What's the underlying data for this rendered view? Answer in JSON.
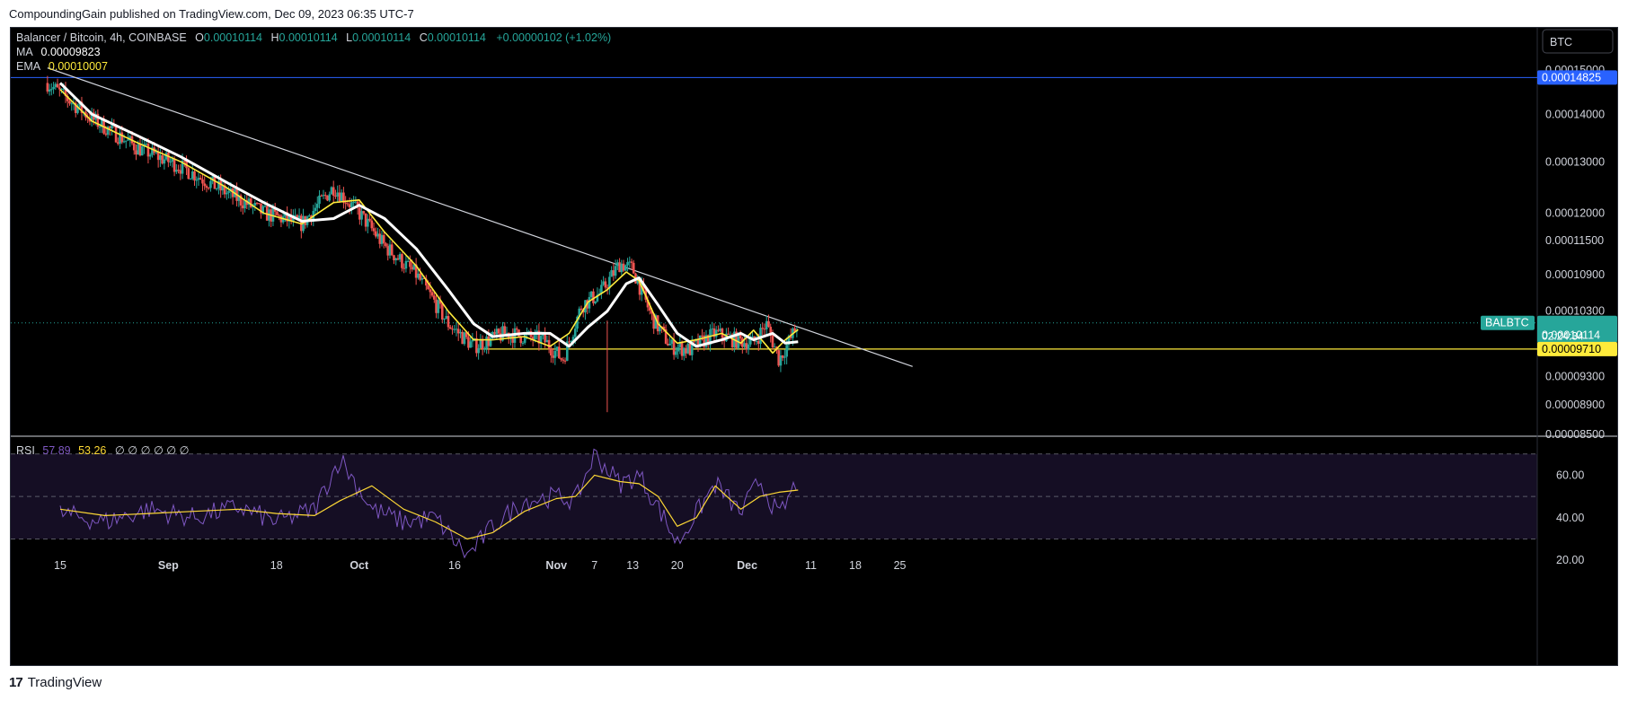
{
  "header": {
    "published": "CompoundingGain published on TradingView.com, Dec 09, 2023 06:35 UTC-7"
  },
  "legend": {
    "symbol": "Balancer / Bitcoin, 4h, COINBASE",
    "o_label": "O",
    "o_value": "0.00010114",
    "h_label": "H",
    "h_value": "0.00010114",
    "l_label": "L",
    "l_value": "0.00010114",
    "c_label": "C",
    "c_value": "0.00010114",
    "change": "+0.00000102 (+1.02%)",
    "ma_label": "MA",
    "ma_value": "0.00009823",
    "ema_label": "EMA",
    "ema_value": "0.00010007",
    "rsi_label": "RSI",
    "rsi_value": "57.89",
    "rsi_ma_value": "53.26",
    "rsi_extra": "∅ ∅ ∅ ∅ ∅ ∅"
  },
  "currency_button": "BTC",
  "badges": {
    "blue_line": "0.00014825",
    "symbol_tag": "BALBTC",
    "last_price": "0.00010114",
    "countdown": "02:24:34",
    "support": "0.00009710"
  },
  "footer": {
    "brand": "TradingView",
    "logo": "17"
  },
  "colors": {
    "up": "#26a69a",
    "down": "#ef5350",
    "ma": "#ffffff",
    "ema": "#ffeb3b",
    "rsi": "#7e57c2",
    "rsi_ma": "#fdd835",
    "blue_line": "#2962ff",
    "support": "#ffeb3b",
    "trendline": "#d1d4dc"
  },
  "chart_data": [
    {
      "type": "candlestick",
      "title": "Balancer / Bitcoin, 4h, COINBASE",
      "y_scale": "log",
      "ylim": [
        8.3e-05,
        0.000154
      ],
      "y_ticks": [
        "0.00015000",
        "0.00014000",
        "0.00013000",
        "0.00012000",
        "0.00011500",
        "0.00010900",
        "0.00010300",
        "0.00009300",
        "0.00008900",
        "0.00008500"
      ],
      "x_ticks": [
        "15",
        "Sep",
        "18",
        "Oct",
        "16",
        "Nov",
        "7",
        "13",
        "20",
        "Dec",
        "11",
        "18",
        "25"
      ],
      "series": [
        {
          "name": "MA",
          "points": [
            [
              "Aug 15",
              0.000147
            ],
            [
              "Aug 20",
              0.00014
            ],
            [
              "Aug 27",
              0.0001355
            ],
            [
              "Sep 3",
              0.000131
            ],
            [
              "Sep 10",
              0.000126
            ],
            [
              "Sep 16",
              0.000122
            ],
            [
              "Sep 22",
              0.0001185
            ],
            [
              "Sep 27",
              0.000119
            ],
            [
              "Oct 1",
              0.0001215
            ],
            [
              "Oct 5",
              0.000119
            ],
            [
              "Oct 10",
              0.0001135
            ],
            [
              "Oct 15",
              0.0001065
            ],
            [
              "Oct 19",
              0.000101
            ],
            [
              "Oct 22",
              9.9e-05
            ],
            [
              "Oct 27",
              9.95e-05
            ],
            [
              "Oct 31",
              9.95e-05
            ],
            [
              "Nov 3",
              9.75e-05
            ],
            [
              "Nov 6",
              0.0001005
            ],
            [
              "Nov 9",
              0.000103
            ],
            [
              "Nov 12",
              0.0001075
            ],
            [
              "Nov 14",
              0.0001085
            ],
            [
              "Nov 17",
              0.000104
            ],
            [
              "Nov 20",
              9.95e-05
            ],
            [
              "Nov 23",
              9.75e-05
            ],
            [
              "Nov 27",
              9.85e-05
            ],
            [
              "Nov 30",
              9.95e-05
            ],
            [
              "Dec 2",
              9.85e-05
            ],
            [
              "Dec 5",
              9.95e-05
            ],
            [
              "Dec 7",
              9.8e-05
            ],
            [
              "Dec 9",
              9.82e-05
            ]
          ]
        },
        {
          "name": "EMA",
          "points": [
            [
              "Aug 15",
              0.0001455
            ],
            [
              "Aug 20",
              0.0001385
            ],
            [
              "Aug 27",
              0.000134
            ],
            [
              "Sep 3",
              0.00013
            ],
            [
              "Sep 10",
              0.000125
            ],
            [
              "Sep 16",
              0.00012
            ],
            [
              "Sep 22",
              0.000118
            ],
            [
              "Sep 27",
              0.000122
            ],
            [
              "Oct 1",
              0.0001225
            ],
            [
              "Oct 5",
              0.0001165
            ],
            [
              "Oct 10",
              0.0001105
            ],
            [
              "Oct 15",
              0.000103
            ],
            [
              "Oct 19",
              9.85e-05
            ],
            [
              "Oct 22",
              9.85e-05
            ],
            [
              "Oct 27",
              9.9e-05
            ],
            [
              "Oct 31",
              9.75e-05
            ],
            [
              "Nov 3",
              9.95e-05
            ],
            [
              "Nov 6",
              0.0001045
            ],
            [
              "Nov 9",
              0.0001065
            ],
            [
              "Nov 12",
              0.0001095
            ],
            [
              "Nov 14",
              0.000108
            ],
            [
              "Nov 17",
              0.000101
            ],
            [
              "Nov 20",
              9.8e-05
            ],
            [
              "Nov 23",
              9.85e-05
            ],
            [
              "Nov 27",
              9.95e-05
            ],
            [
              "Nov 30",
              9.8e-05
            ],
            [
              "Dec 2",
              0.0001
            ],
            [
              "Dec 5",
              9.65e-05
            ],
            [
              "Dec 7",
              9.85e-05
            ],
            [
              "Dec 9",
              0.0001001
            ]
          ]
        }
      ],
      "price_path": [
        [
          "Aug 13",
          0.000147
        ],
        [
          "Aug 20",
          0.000139
        ],
        [
          "Aug 27",
          0.000133
        ],
        [
          "Sep 3",
          0.000129
        ],
        [
          "Sep 10",
          0.000124
        ],
        [
          "Sep 16",
          0.00012
        ],
        [
          "Sep 22",
          0.000118
        ],
        [
          "Sep 27",
          0.000125
        ],
        [
          "Oct 1",
          0.00012
        ],
        [
          "Oct 5",
          0.000114
        ],
        [
          "Oct 10",
          0.000109
        ],
        [
          "Oct 15",
          0.000101
        ],
        [
          "Oct 19",
          9.75e-05
        ],
        [
          "Oct 24",
          9.95e-05
        ],
        [
          "Oct 30",
          9.85e-05
        ],
        [
          "Nov 2",
          9.55e-05
        ],
        [
          "Nov 5",
          0.000104
        ],
        [
          "Nov 8",
          0.000106
        ],
        [
          "Nov 11",
          0.000111
        ],
        [
          "Nov 13",
          0.00011
        ],
        [
          "Nov 16",
          0.000102
        ],
        [
          "Nov 19",
          9.75e-05
        ],
        [
          "Nov 22",
          9.7e-05
        ],
        [
          "Nov 26",
          9.95e-05
        ],
        [
          "Nov 29",
          9.85e-05
        ],
        [
          "Dec 2",
          9.8e-05
        ],
        [
          "Dec 4",
          0.000101
        ],
        [
          "Dec 6",
          9.55e-05
        ],
        [
          "Dec 8",
          9.9e-05
        ],
        [
          "Dec 9",
          0.0001011
        ]
      ],
      "candle_colors": "green = up, red = down",
      "horizontal_lines": [
        {
          "value": 0.00014825,
          "label": "0.00014825"
        },
        {
          "value": 9.71e-05,
          "label": "0.00009710",
          "from": "Oct 20"
        }
      ],
      "trendline": {
        "from": [
          "Aug 13",
          0.0001505
        ],
        "to": [
          "Dec 27",
          9.45e-05
        ]
      },
      "wick_spike_low": [
        "Nov 9",
        8.8e-05
      ]
    },
    {
      "type": "line",
      "title": "RSI",
      "ylim": [
        15,
        72
      ],
      "y_ticks": [
        "60.00",
        "40.00",
        "20.00"
      ],
      "bands": [
        30,
        50,
        70
      ],
      "series": [
        {
          "name": "RSI",
          "points": [
            [
              "Aug 15",
              42
            ],
            [
              "Aug 22",
              38
            ],
            [
              "Aug 29",
              44
            ],
            [
              "Sep 5",
              40
            ],
            [
              "Sep 12",
              45
            ],
            [
              "Sep 18",
              38
            ],
            [
              "Sep 24",
              44
            ],
            [
              "Sep 28",
              68
            ],
            [
              "Oct 3",
              44
            ],
            [
              "Oct 8",
              38
            ],
            [
              "Oct 13",
              40
            ],
            [
              "Oct 18",
              22
            ],
            [
              "Oct 22",
              36
            ],
            [
              "Oct 27",
              48
            ],
            [
              "Nov 1",
              50
            ],
            [
              "Nov 4",
              48
            ],
            [
              "Nov 7",
              70
            ],
            [
              "Nov 11",
              56
            ],
            [
              "Nov 14",
              60
            ],
            [
              "Nov 17",
              45
            ],
            [
              "Nov 20",
              28
            ],
            [
              "Nov 23",
              42
            ],
            [
              "Nov 26",
              56
            ],
            [
              "Nov 30",
              42
            ],
            [
              "Dec 3",
              58
            ],
            [
              "Dec 6",
              40
            ],
            [
              "Dec 9",
              58
            ]
          ]
        },
        {
          "name": "RSI MA",
          "points": [
            [
              "Aug 15",
              44
            ],
            [
              "Aug 22",
              41
            ],
            [
              "Aug 29",
              42
            ],
            [
              "Sep 5",
              43
            ],
            [
              "Sep 12",
              44
            ],
            [
              "Sep 18",
              42
            ],
            [
              "Sep 24",
              41
            ],
            [
              "Sep 28",
              48
            ],
            [
              "Oct 3",
              55
            ],
            [
              "Oct 8",
              44
            ],
            [
              "Oct 13",
              38
            ],
            [
              "Oct 18",
              30
            ],
            [
              "Oct 22",
              33
            ],
            [
              "Oct 27",
              43
            ],
            [
              "Nov 1",
              49
            ],
            [
              "Nov 4",
              50
            ],
            [
              "Nov 7",
              60
            ],
            [
              "Nov 11",
              57
            ],
            [
              "Nov 14",
              56
            ],
            [
              "Nov 17",
              50
            ],
            [
              "Nov 20",
              36
            ],
            [
              "Nov 23",
              40
            ],
            [
              "Nov 26",
              55
            ],
            [
              "Nov 30",
              44
            ],
            [
              "Dec 3",
              50
            ],
            [
              "Dec 6",
              52
            ],
            [
              "Dec 9",
              53
            ]
          ]
        }
      ]
    }
  ]
}
